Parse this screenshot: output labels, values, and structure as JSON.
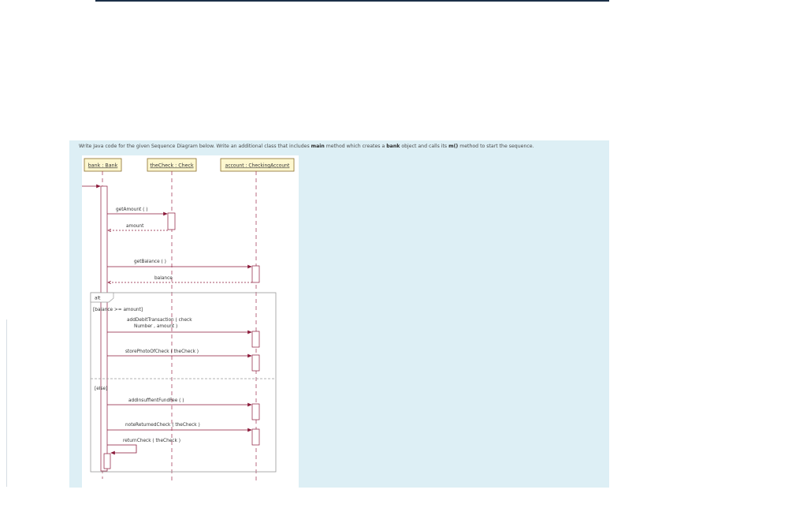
{
  "instruction": {
    "part1": "Write Java code for the given Sequence Diagram below. Write an additional class that includes ",
    "bold1": "main",
    "part2": " method which creates a ",
    "bold2": "bank",
    "part3": " object and calls its ",
    "bold3": "m()",
    "part4": " method to start the sequence."
  },
  "lifelines": {
    "bank": "bank : Bank",
    "check": "theCheck : Check",
    "account": "account : CheckingAccount"
  },
  "messages": {
    "get_amount": "getAmount ( )",
    "amount_return": "amount",
    "get_balance": "getBalance ( )",
    "balance_return": "balance",
    "add_debit_1": "addDebitTransaction ( check",
    "add_debit_2": "Number , amount )",
    "store_photo": "storePhotoOfCheck ( theCheck )",
    "add_fee": "addInsuffientFundFee ( )",
    "note_returned": "noteReturnedCheck ( theCheck )",
    "return_check": "returnCheck ( theCheck )"
  },
  "fragment": {
    "operator": "alt",
    "guard_if": "[balance >= amount]",
    "guard_else": "[else]"
  },
  "colors": {
    "panel_bg": "#ddeff5",
    "lifeline_box": "#fdf7cf",
    "lifeline_border": "#8a6d2a",
    "arrow": "#8b1a3a",
    "lifeline_dash": "#9b2d4d"
  }
}
